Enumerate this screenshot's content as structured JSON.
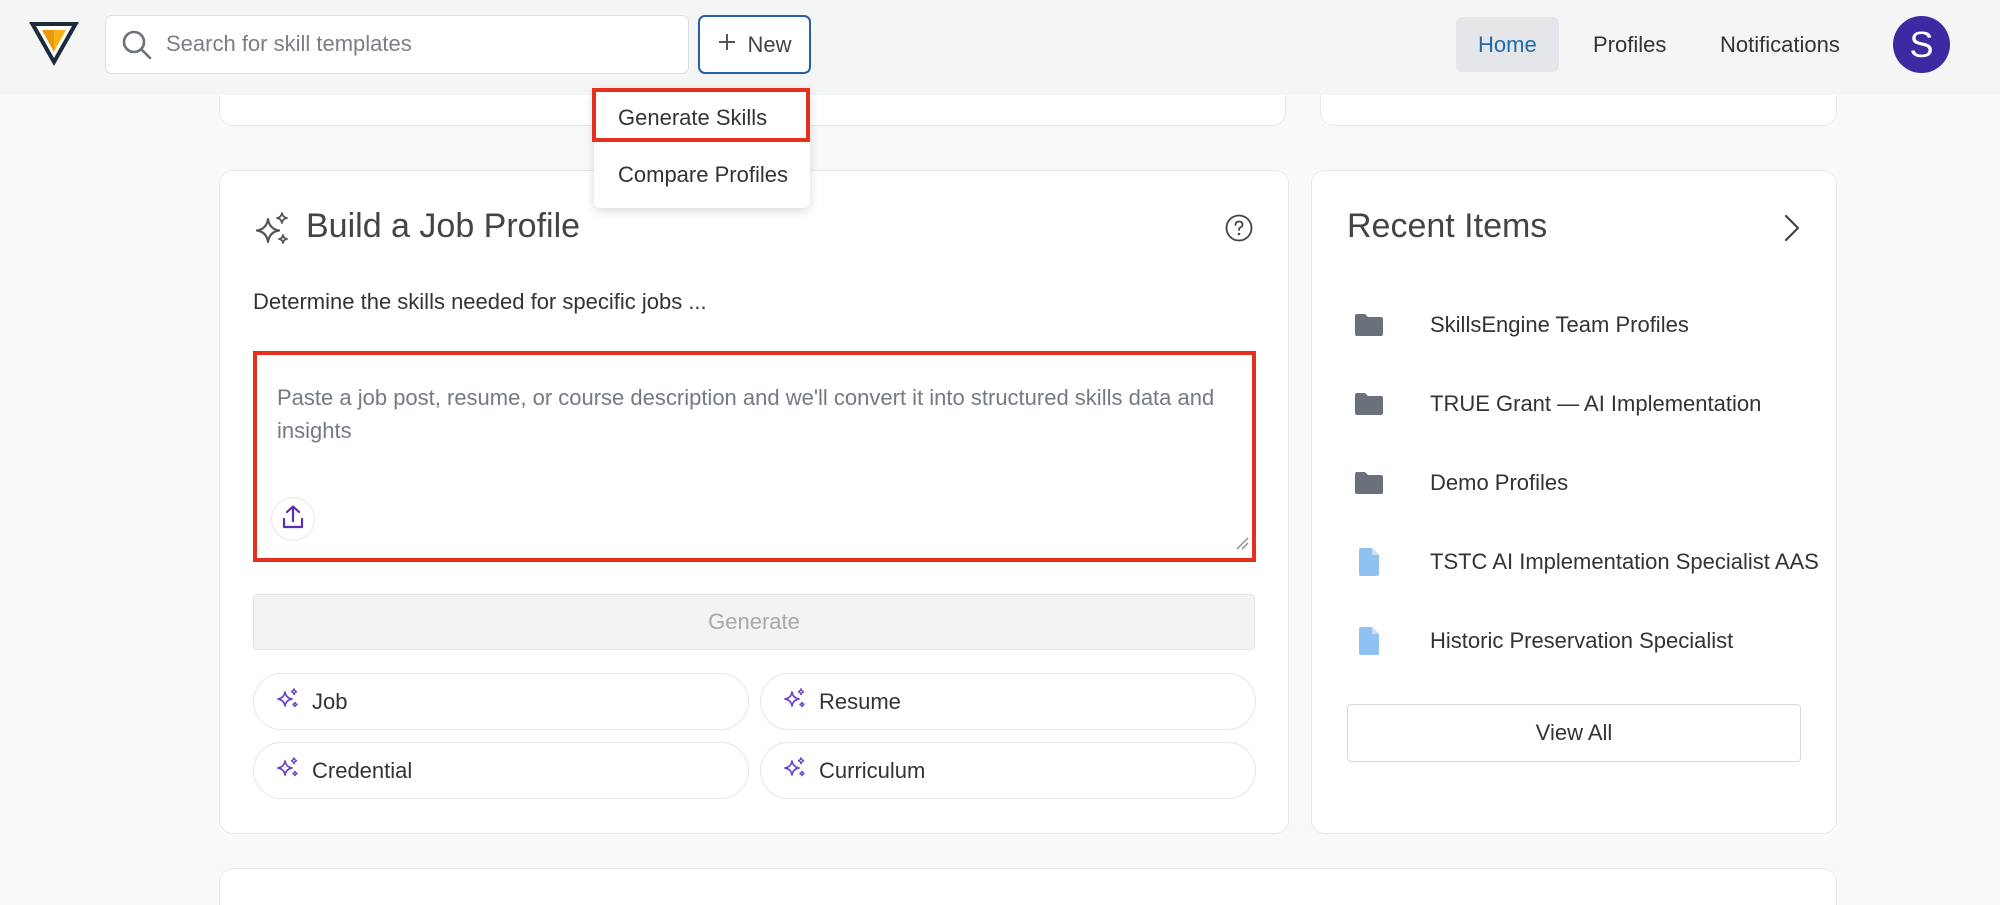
{
  "header": {
    "logo": "skillsengine-logo",
    "search": {
      "placeholder": "Search for skill templates",
      "value": "",
      "icon": "search-icon"
    },
    "new_button": {
      "label": "New",
      "icon": "plus-icon"
    },
    "nav": [
      {
        "label": "Home",
        "active": true
      },
      {
        "label": "Profiles",
        "active": false
      },
      {
        "label": "Notifications",
        "active": false
      }
    ],
    "avatar_initial": "S"
  },
  "new_menu": {
    "items": [
      {
        "label": "Generate Skills",
        "highlighted": true
      },
      {
        "label": "Compare Profiles",
        "highlighted": false
      }
    ]
  },
  "build_profile": {
    "title": "Build a Job Profile",
    "title_icon": "sparkle-icon",
    "help_icon": "question-circle-icon",
    "subtitle": "Determine the skills needed for specific jobs ...",
    "textarea": {
      "placeholder": "Paste a job post, resume, or course description and we'll convert it into structured skills data and insights",
      "value": ""
    },
    "upload_icon": "upload-icon",
    "generate_label": "Generate",
    "chips": [
      {
        "label": "Job"
      },
      {
        "label": "Resume"
      },
      {
        "label": "Credential"
      },
      {
        "label": "Curriculum"
      }
    ]
  },
  "recent": {
    "title": "Recent Items",
    "items": [
      {
        "label": "SkillsEngine Team Profiles",
        "icon": "folder-icon"
      },
      {
        "label": "TRUE Grant — AI Implementation",
        "icon": "folder-icon"
      },
      {
        "label": "Demo Profiles",
        "icon": "folder-icon"
      },
      {
        "label": "TSTC AI Implementation Specialist AAS",
        "icon": "document-icon"
      },
      {
        "label": "Historic Preservation Specialist",
        "icon": "document-icon"
      }
    ],
    "view_all_label": "View All"
  },
  "colors": {
    "brand_blue": "#1f6aa8",
    "avatar_purple": "#3d2aa3",
    "highlight_red": "#e5301f",
    "folder_gray": "#6b717a",
    "doc_blue": "#8fc2f0",
    "sparkle_purple": "#6a45c8"
  }
}
